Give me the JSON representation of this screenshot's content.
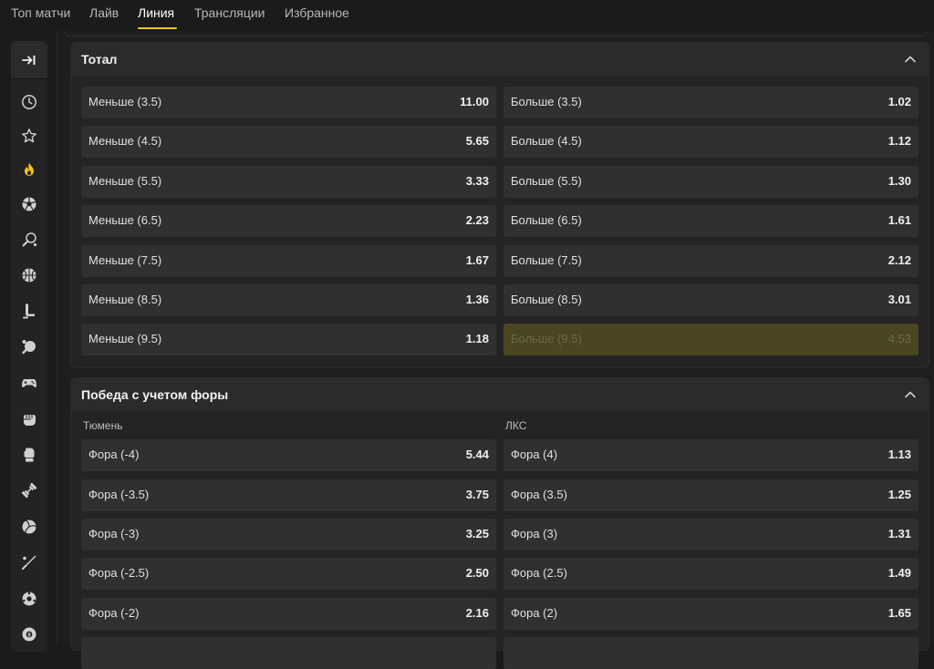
{
  "tabs": [
    {
      "label": "Топ матчи",
      "active": false
    },
    {
      "label": "Лайв",
      "active": false
    },
    {
      "label": "Линия",
      "active": true
    },
    {
      "label": "Трансляции",
      "active": false
    },
    {
      "label": "Избранное",
      "active": false
    }
  ],
  "accent_color": "#f0c41b",
  "sidebar": {
    "toggle_icon": "collapse-arrow-icon",
    "icons": [
      "clock-icon",
      "star-icon",
      "fire-icon",
      "football-icon",
      "tennis-icon",
      "basketball-icon",
      "hockey-icon",
      "table-tennis-icon",
      "gamepad-icon",
      "fist-icon",
      "boxing-glove-icon",
      "dumbbell-icon",
      "volleyball-icon",
      "baseball-icon",
      "soccer-ball-icon",
      "billiards-icon"
    ]
  },
  "total": {
    "title": "Тотал",
    "rows": [
      {
        "under_label": "Меньше (3.5)",
        "under_odd": "11.00",
        "over_label": "Больше (3.5)",
        "over_odd": "1.02"
      },
      {
        "under_label": "Меньше (4.5)",
        "under_odd": "5.65",
        "over_label": "Больше (4.5)",
        "over_odd": "1.12"
      },
      {
        "under_label": "Меньше (5.5)",
        "under_odd": "3.33",
        "over_label": "Больше (5.5)",
        "over_odd": "1.30"
      },
      {
        "under_label": "Меньше (6.5)",
        "under_odd": "2.23",
        "over_label": "Больше (6.5)",
        "over_odd": "1.61"
      },
      {
        "under_label": "Меньше (7.5)",
        "under_odd": "1.67",
        "over_label": "Больше (7.5)",
        "over_odd": "2.12"
      },
      {
        "under_label": "Меньше (8.5)",
        "under_odd": "1.36",
        "over_label": "Больше (8.5)",
        "over_odd": "3.01"
      },
      {
        "under_label": "Меньше (9.5)",
        "under_odd": "1.18",
        "over_label": "Больше (9.5)",
        "over_odd": "4.53",
        "over_disabled": true
      }
    ]
  },
  "handicap": {
    "title": "Победа с учетом форы",
    "team1": "Тюмень",
    "team2": "ЛКС",
    "rows": [
      {
        "left_label": "Фора (-4)",
        "left_odd": "5.44",
        "right_label": "Фора (4)",
        "right_odd": "1.13"
      },
      {
        "left_label": "Фора (-3.5)",
        "left_odd": "3.75",
        "right_label": "Фора (3.5)",
        "right_odd": "1.25"
      },
      {
        "left_label": "Фора (-3)",
        "left_odd": "3.25",
        "right_label": "Фора (3)",
        "right_odd": "1.31"
      },
      {
        "left_label": "Фора (-2.5)",
        "left_odd": "2.50",
        "right_label": "Фора (2.5)",
        "right_odd": "1.49"
      },
      {
        "left_label": "Фора (-2)",
        "left_odd": "2.16",
        "right_label": "Фора (2)",
        "right_odd": "1.65"
      }
    ]
  }
}
